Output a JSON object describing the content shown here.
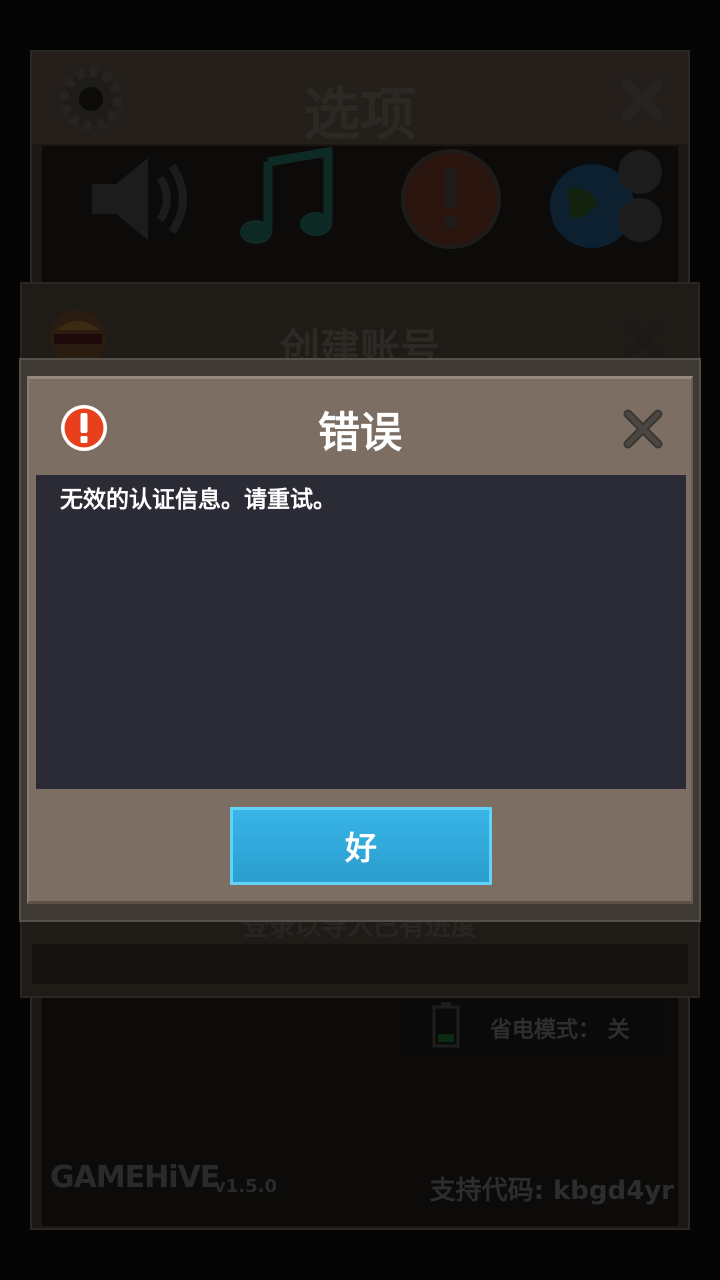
{
  "options_panel": {
    "title": "选项",
    "icons": [
      "gear-icon",
      "close-icon",
      "speaker-icon",
      "music-note-icon",
      "alert-icon",
      "language-globe-icon",
      "battery-icon"
    ],
    "battery_saver_label": "省电模式： 关",
    "brand": "GAMEHiVE",
    "version": "v1.5.0",
    "support_code": "支持代码: kbgd4yr"
  },
  "account_panel": {
    "title": "创建账号",
    "login_text": "登录以导入已有进度"
  },
  "error_dialog": {
    "title": "错误",
    "message": "无效的认证信息。请重试。",
    "ok_label": "好"
  },
  "colors": {
    "dialog_bg": "#7c6e63",
    "body_bg": "#2b2b35",
    "button_bg": "#2fa9dc",
    "error_red": "#e8401c"
  }
}
